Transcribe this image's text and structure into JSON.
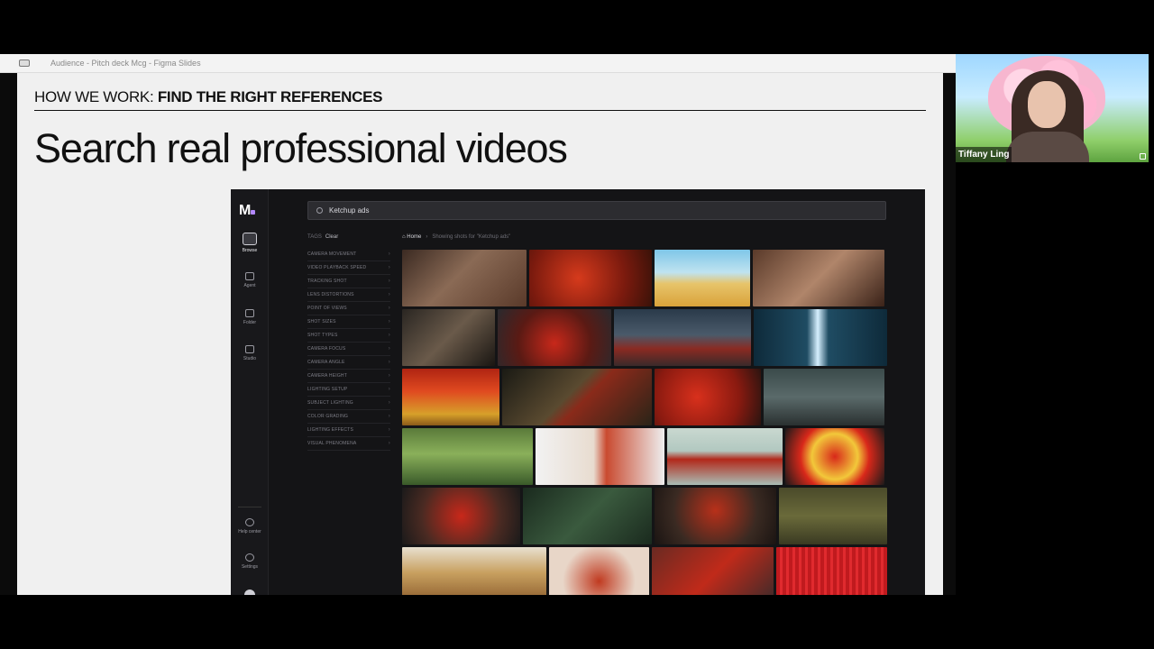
{
  "window": {
    "title": "Audience - Pitch deck Mcg - Figma Slides"
  },
  "slide": {
    "header_prefix": "HOW WE WORK: ",
    "header_bold": "FIND THE RIGHT REFERENCES",
    "title": "Search real professional videos"
  },
  "app": {
    "search": {
      "query": "Ketchup ads"
    },
    "rail": {
      "browse": "Browse",
      "agent": "Agent",
      "folder": "Folder",
      "studio": "Studio",
      "help": "Help center",
      "settings": "Settings"
    },
    "tags": {
      "title": "TAGS",
      "clear": "Clear",
      "items": [
        "CAMERA MOVEMENT",
        "VIDEO PLAYBACK SPEED",
        "TRACKING SHOT",
        "LENS DISTORTIONS",
        "POINT OF VIEWS",
        "SHOT SIZES",
        "SHOT TYPES",
        "CAMERA FOCUS",
        "CAMERA ANGLE",
        "CAMERA HEIGHT",
        "LIGHTING SETUP",
        "SUBJECT LIGHTING",
        "COLOR GRADING",
        "LIGHTING EFFECTS",
        "VISUAL PHENOMENA"
      ]
    },
    "breadcrumb": {
      "home": "Home",
      "showing": "Showing shots for \"Ketchup ads\""
    },
    "thumbnail_rows": [
      [
        {
          "w": 138,
          "bg": "linear-gradient(135deg,#3b2a22,#8a6a55 45%,#5a3a2a)"
        },
        {
          "w": 136,
          "bg": "radial-gradient(circle at 40% 50%,#d63a1c,#7a1a0e 60%,#3a1208)"
        },
        {
          "w": 106,
          "bg": "linear-gradient(180deg,#7fc6e8,#bfe3f0 40%,#e7c46a 60%,#d9a23a)"
        },
        {
          "w": 146,
          "bg": "linear-gradient(135deg,#5a3a2a,#b0856a 50%,#3a2218)"
        }
      ],
      [
        {
          "w": 103,
          "bg": "linear-gradient(135deg,#2a2622,#6a5a4a 50%,#1a1612)"
        },
        {
          "w": 126,
          "bg": "radial-gradient(circle at 50% 60%,#c8281a,#5a1a14 55%,#2a2a2e)"
        },
        {
          "w": 152,
          "bg": "linear-gradient(180deg,#2a3a4a,#4a5a6a 45%,#8a2a22 70%,#3a2a2a)"
        },
        {
          "w": 148,
          "bg": "linear-gradient(90deg,#0e2a3a,#1f4c63 40%,#d6f0ff 48%,#1f4c63 56%,#0e2a3a)"
        }
      ],
      [
        {
          "w": 108,
          "bg": "linear-gradient(180deg,#b02412,#e04a20 40%,#d7a02a 80%,#8a5a1a)"
        },
        {
          "w": 166,
          "bg": "linear-gradient(135deg,#1a1a14,#5a4a30 45%,#8a2a1a 55%,#2a2418)"
        },
        {
          "w": 118,
          "bg": "radial-gradient(circle at 40% 50%,#d8301c,#8a1a10 60%,#2a1410)"
        },
        {
          "w": 134,
          "bg": "linear-gradient(180deg,#3a4a4a,#5a6a6a 50%,#2a3030)"
        }
      ],
      [
        {
          "w": 145,
          "bg": "linear-gradient(180deg,#5a7a3a,#8ab05a 45%,#3a5a2a)"
        },
        {
          "w": 143,
          "bg": "linear-gradient(90deg,#f2f2f2,#e8dcd0 45%,#c94a30 55%,#eeeeee)"
        },
        {
          "w": 128,
          "bg": "linear-gradient(180deg,#c9d8d0,#b2c8c0 40%,#b2281a 55%,#a9bdb5)"
        },
        {
          "w": 110,
          "bg": "radial-gradient(circle at 50% 50%,#d8281a,#f2c83a 40%,#d8281a 60%,#1a1a1a)"
        }
      ],
      [
        {
          "w": 131,
          "bg": "radial-gradient(circle at 50% 50%,#c8281a,#4a2a22 60%,#1a1a1a)"
        },
        {
          "w": 143,
          "bg": "linear-gradient(135deg,#1a2a1e,#3a5a3e 50%,#1a2a1e)"
        },
        {
          "w": 135,
          "bg": "radial-gradient(circle at 50% 40%,#b8301a,#3a2a22 60%,#1a1412)"
        },
        {
          "w": 120,
          "bg": "linear-gradient(180deg,#4a4a2a,#6a6a3a 50%,#3a3a22)"
        }
      ],
      [
        {
          "w": 161,
          "bg": "linear-gradient(180deg,#e8e0d0,#c8a060 45%,#8a5a2a)"
        },
        {
          "w": 111,
          "bg": "radial-gradient(circle at 50% 60%,#c03a20,#e8d6c8 60%)"
        },
        {
          "w": 136,
          "bg": "linear-gradient(135deg,#6a2a22,#c02a1a 50%,#3a2a2a)"
        },
        {
          "w": 123,
          "bg": "repeating-linear-gradient(90deg,#c01a1e 0 4px,#e02a2e 4px 7px)"
        }
      ]
    ]
  },
  "participant": {
    "name": "Tiffany Ling"
  }
}
